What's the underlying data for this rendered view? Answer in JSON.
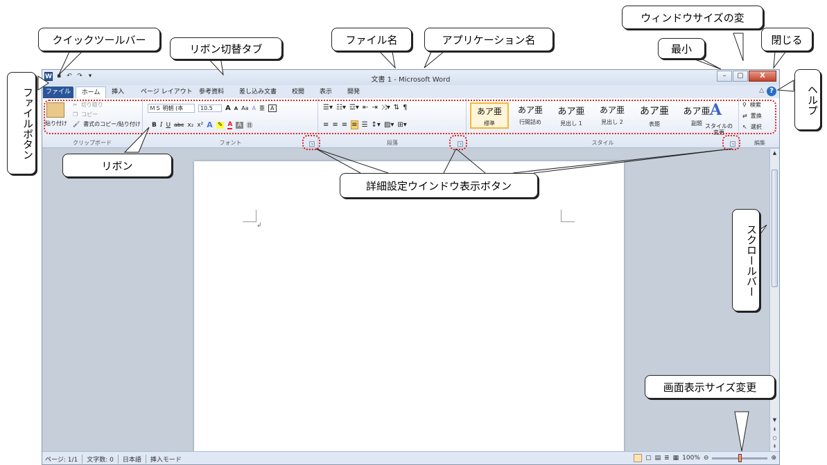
{
  "window": {
    "title": "文書 1 - Microsoft Word",
    "logo": "W",
    "qat_icons": [
      "save-icon",
      "undo-icon",
      "redo-icon",
      "qat-customize-icon"
    ],
    "buttons": {
      "minimize": "–",
      "maximize": "▢",
      "close": "X"
    }
  },
  "tabs": [
    "ファイル",
    "ホーム",
    "挿入",
    "ページ レイアウト",
    "参考資料",
    "差し込み文書",
    "校閲",
    "表示",
    "開発"
  ],
  "help": "?",
  "ribbon": {
    "clipboard": {
      "label": "クリップボード",
      "paste": "貼り付け",
      "cut": "切り取り",
      "copy": "コピー",
      "format_painter": "書式のコピー/貼り付け"
    },
    "font": {
      "label": "フォント",
      "font_name": "ＭＳ 明朝 (本",
      "font_size": "10.5",
      "bold": "B",
      "italic": "I",
      "underline": "U",
      "strike": "abc",
      "sub": "x₂",
      "sup": "x²",
      "grow": "A",
      "shrink": "A",
      "case": "Aa",
      "clear": "A",
      "phonetic": "亜",
      "border": "A",
      "shade": "A",
      "encircle": "㊐"
    },
    "paragraph": {
      "label": "段落"
    },
    "styles": {
      "label": "スタイル",
      "items": [
        {
          "preview": "あア亜",
          "name": "標準"
        },
        {
          "preview": "あア亜",
          "name": "行間詰め"
        },
        {
          "preview": "あア亜",
          "name": "見出し 1"
        },
        {
          "preview": "あア亜",
          "name": "見出し 2"
        },
        {
          "preview": "あア亜",
          "name": "表題"
        },
        {
          "preview": "あア亜",
          "name": "副題"
        }
      ],
      "change": "スタイルの変更"
    },
    "editing": {
      "label": "編集",
      "find": "検索",
      "replace": "置換",
      "select": "選択"
    }
  },
  "status": {
    "page": "ページ: 1/1",
    "words": "文字数: 0",
    "lang": "日本語",
    "mode": "挿入モード",
    "zoom": "100%"
  },
  "callouts": {
    "qat": "クイックツールバー",
    "ribbon_tab": "リボン切替タブ",
    "filename": "ファイル名",
    "appname": "アプリケーション名",
    "window_size": "ウィンドウサイズの変",
    "minimize": "最小",
    "close": "閉じる",
    "help": "ヘルプ",
    "file_button": "ファイルボタン",
    "ribbon": "リボン",
    "launcher": "詳細設定ウインドウ表示ボタン",
    "scrollbar": "スクロールバー",
    "zoom": "画面表示サイズ変更"
  }
}
